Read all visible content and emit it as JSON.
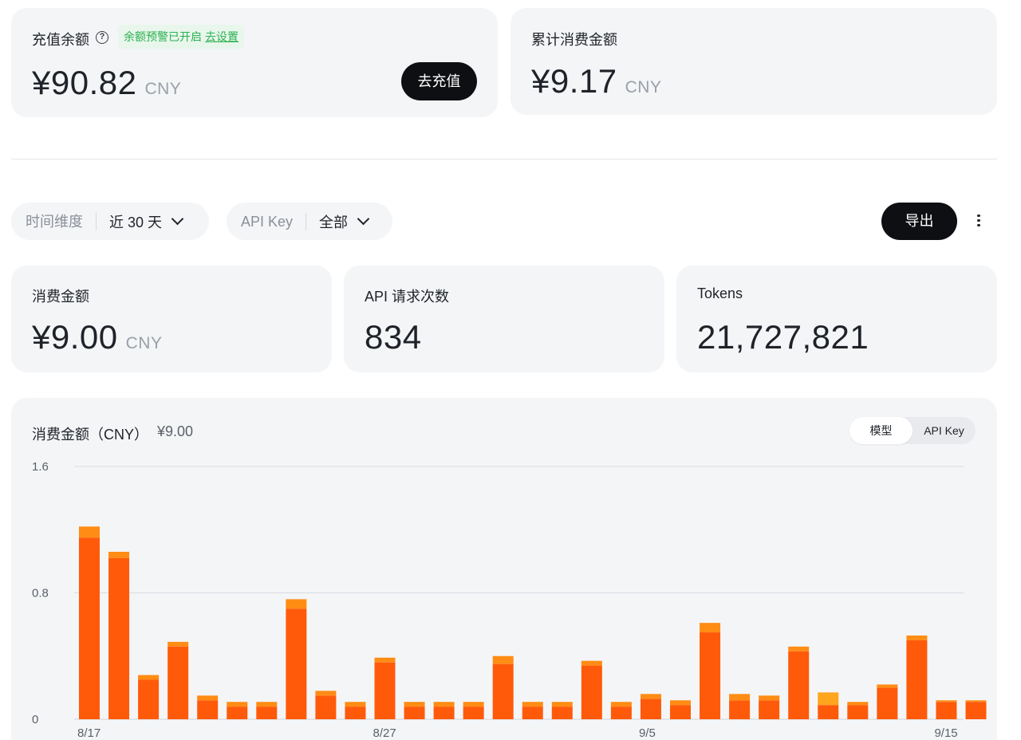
{
  "balance": {
    "label": "充值余额",
    "help_icon": "question-circle-icon",
    "warning_text": "余额预警已开启",
    "warning_link": "去设置",
    "amount": "¥90.82",
    "currency": "CNY",
    "recharge_label": "去充值"
  },
  "total_spent": {
    "label": "累计消费金额",
    "amount": "¥9.17",
    "currency": "CNY"
  },
  "filters": {
    "time": {
      "key": "时间维度",
      "value": "近 30 天"
    },
    "api_key": {
      "key": "API Key",
      "value": "全部"
    },
    "export_label": "导出",
    "more_icon": "more-vertical-icon"
  },
  "stats": {
    "spend": {
      "label": "消费金额",
      "value": "¥9.00",
      "currency": "CNY"
    },
    "requests": {
      "label": "API 请求次数",
      "value": "834"
    },
    "tokens": {
      "label": "Tokens",
      "value": "21,727,821"
    }
  },
  "chart": {
    "title": "消费金额（CNY）",
    "total": "¥9.00",
    "toggle": {
      "model": "模型",
      "api_key": "API Key"
    }
  },
  "chart_data": {
    "type": "bar",
    "stacked": true,
    "ylim": [
      0,
      1.6
    ],
    "yticks": [
      "1.6",
      "0.8",
      "0"
    ],
    "xticks": [
      {
        "index": 0,
        "label": "8/17"
      },
      {
        "index": 10,
        "label": "8/27"
      },
      {
        "index": 19,
        "label": "9/5"
      },
      {
        "index": 29,
        "label": "9/15"
      }
    ],
    "colors": {
      "primary": "#ff5a0a",
      "secondary": "#ff8c14",
      "tertiary": "#ffa51e"
    },
    "categories": [
      "8/17",
      "8/18",
      "8/19",
      "8/20",
      "8/21",
      "8/22",
      "8/23",
      "8/24",
      "8/25",
      "8/26",
      "8/27",
      "8/28",
      "8/29",
      "8/30",
      "8/31",
      "9/1",
      "9/2",
      "9/3",
      "9/4",
      "9/5",
      "9/6",
      "9/7",
      "9/8",
      "9/9",
      "9/10",
      "9/11",
      "9/12",
      "9/13",
      "9/14",
      "9/15",
      "9/16"
    ],
    "series": [
      {
        "values": [
          1.15,
          1.02,
          0.25,
          0.46,
          0.12,
          0.08,
          0.08,
          0.7,
          0.15,
          0.08,
          0.36,
          0.08,
          0.08,
          0.08,
          0.35,
          0.08,
          0.08,
          0.34,
          0.08,
          0.13,
          0.09,
          0.55,
          0.12,
          0.12,
          0.43,
          0.09,
          0.09,
          0.2,
          0.5,
          0.11,
          0.11
        ]
      },
      {
        "values": [
          0.07,
          0.04,
          0.03,
          0.03,
          0.03,
          0.03,
          0.03,
          0.06,
          0.03,
          0.03,
          0.03,
          0.03,
          0.03,
          0.03,
          0.05,
          0.03,
          0.03,
          0.03,
          0.03,
          0.03,
          0.03,
          0.06,
          0.04,
          0.03,
          0.03,
          0.0,
          0.02,
          0.02,
          0.03,
          0.01,
          0.01
        ]
      },
      {
        "values": [
          0,
          0,
          0,
          0,
          0,
          0,
          0,
          0,
          0,
          0,
          0,
          0,
          0,
          0,
          0,
          0,
          0,
          0,
          0,
          0,
          0,
          0,
          0,
          0,
          0,
          0.08,
          0,
          0,
          0,
          0,
          0
        ]
      }
    ]
  }
}
